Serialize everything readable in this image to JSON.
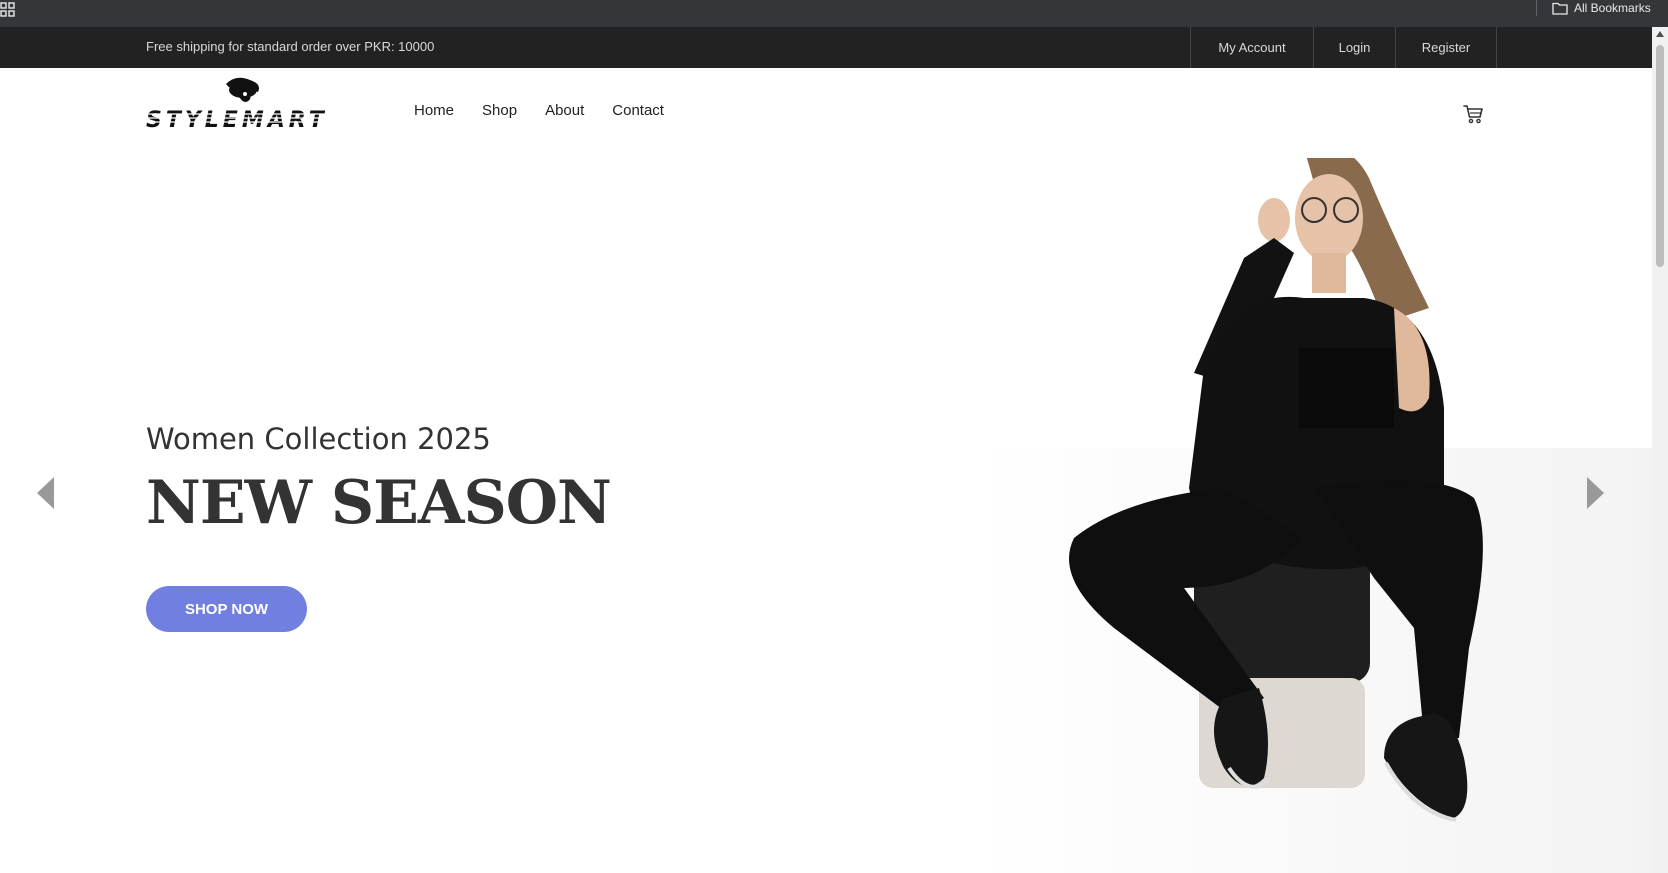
{
  "bookmarks_bar": {
    "all_bookmarks_label": "All Bookmarks"
  },
  "topbar": {
    "promo_text": "Free shipping for standard order over PKR: 10000",
    "links": [
      {
        "label": "My Account"
      },
      {
        "label": "Login"
      },
      {
        "label": "Register"
      }
    ]
  },
  "header": {
    "logo_text": "STYLEMART",
    "nav": [
      {
        "label": "Home"
      },
      {
        "label": "Shop"
      },
      {
        "label": "About"
      },
      {
        "label": "Contact"
      }
    ],
    "cart_icon": "cart-icon"
  },
  "hero": {
    "subtitle": "Women Collection 2025",
    "title": "NEW SEASON",
    "cta_label": "SHOP NOW",
    "prev_icon": "arrow-left-icon",
    "next_icon": "arrow-right-icon"
  },
  "colors": {
    "accent": "#717fe0",
    "topbar_bg": "#222222",
    "browser_bar_bg": "#35363a",
    "text_dark": "#333333"
  }
}
